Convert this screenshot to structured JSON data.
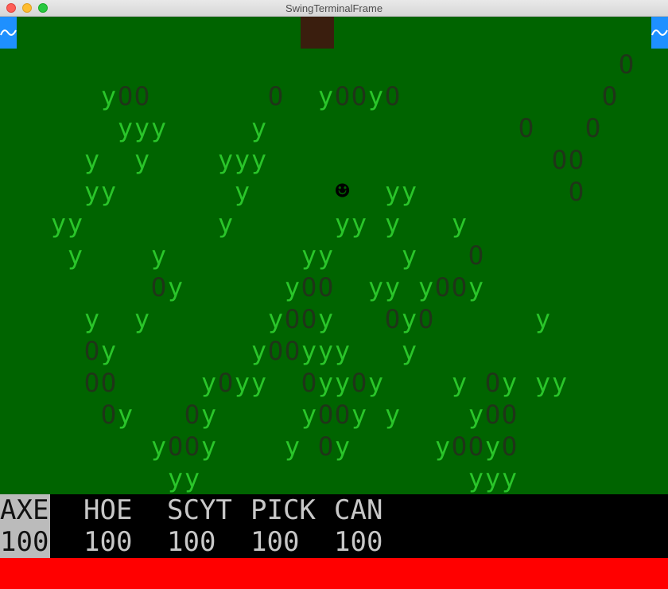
{
  "window": {
    "title": "SwingTerminalFrame"
  },
  "colors": {
    "grass": "#2ac52a",
    "stone": "#1f3518",
    "ground": "#006400",
    "water": "#1e90ff",
    "dirt": "#3a1e0e",
    "health": "#ff0000"
  },
  "map": {
    "rows": [
      "     .             .                     ",
      "                                     O   ",
      "      yOO       O  yOOyO            O   ",
      "       yyy     y               O   O    ",
      "     y  y    yyy                 OO     ",
      "     yy       y     @  yy         O     ",
      "   yy        y      yy y   y            ",
      "    y    y        yy    y   O           ",
      "         Oy      yOO  yy yOOy           ",
      "     y  y       yOOy   OyO      y       ",
      "     Oy        yOOyyy   y               ",
      "     OO     yOyy  OyyOy    y Oy yy      ",
      "      Oy   Oy     yOOy y    yOO         ",
      "         yOOy    y Oy     yOOyO         ",
      "          yy                yyy         "
    ],
    "water_icon": "water-icon",
    "dirt_label": "dirt-tile",
    "player_icon": "smiley-face-icon",
    "player_glyph": "☻"
  },
  "hud": {
    "tools": [
      {
        "name": "AXE",
        "count": "100",
        "selected": true
      },
      {
        "name": "HOE",
        "count": "100",
        "selected": false
      },
      {
        "name": "SCYT",
        "count": "100",
        "selected": false
      },
      {
        "name": "PICK",
        "count": "100",
        "selected": false
      },
      {
        "name": "CAN",
        "count": "100",
        "selected": false
      }
    ]
  },
  "health": {
    "fraction": 1.0
  }
}
